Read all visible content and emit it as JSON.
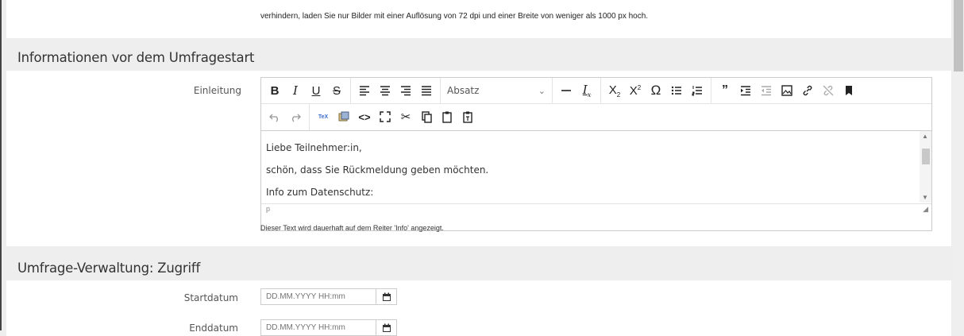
{
  "top_note": {
    "text": "verhindern, laden Sie nur Bilder mit einer Auflösung von 72 dpi und einer Breite von weniger als 1000 px hoch."
  },
  "intro_section": {
    "title": "Informationen vor dem Umfragestart",
    "field_label": "Einleitung",
    "format_select": "Absatz",
    "toolbar_row1_icons": [
      "bold-icon",
      "italic-icon",
      "underline-icon",
      "strikethrough-icon",
      "align-left-icon",
      "align-center-icon",
      "align-right-icon",
      "align-justify-icon",
      "chevron-down-icon",
      "horizontal-rule-icon",
      "clear-format-icon",
      "subscript-icon",
      "superscript-icon",
      "omega-icon",
      "bullet-list-icon",
      "numbered-list-icon",
      "blockquote-icon",
      "indent-icon",
      "outdent-icon",
      "image-icon",
      "link-icon",
      "unlink-icon",
      "bookmark-icon"
    ],
    "toolbar_row2_icons": [
      "undo-icon",
      "redo-icon",
      "tex-icon",
      "media-icon",
      "source-code-icon",
      "fullscreen-icon",
      "cut-icon",
      "copy-icon",
      "paste-icon",
      "paste-text-icon"
    ],
    "editor_lines": [
      "Liebe Teilnehmer:in,",
      "schön, dass Sie Rückmeldung geben möchten.",
      "Info zum Datenschutz:"
    ],
    "status_path": "p",
    "help_text": "Dieser Text wird dauerhaft auf dem Reiter 'Info' angezeigt."
  },
  "access_section": {
    "title": "Umfrage-Verwaltung: Zugriff",
    "start_label": "Startdatum",
    "start_placeholder": "DD.MM.YYYY HH:mm",
    "end_label": "Enddatum",
    "end_placeholder": "DD.MM.YYYY HH:mm"
  },
  "colors": {
    "background": "#eeeeee",
    "panel": "#ffffff",
    "border": "#cccccc",
    "text": "#333333"
  }
}
